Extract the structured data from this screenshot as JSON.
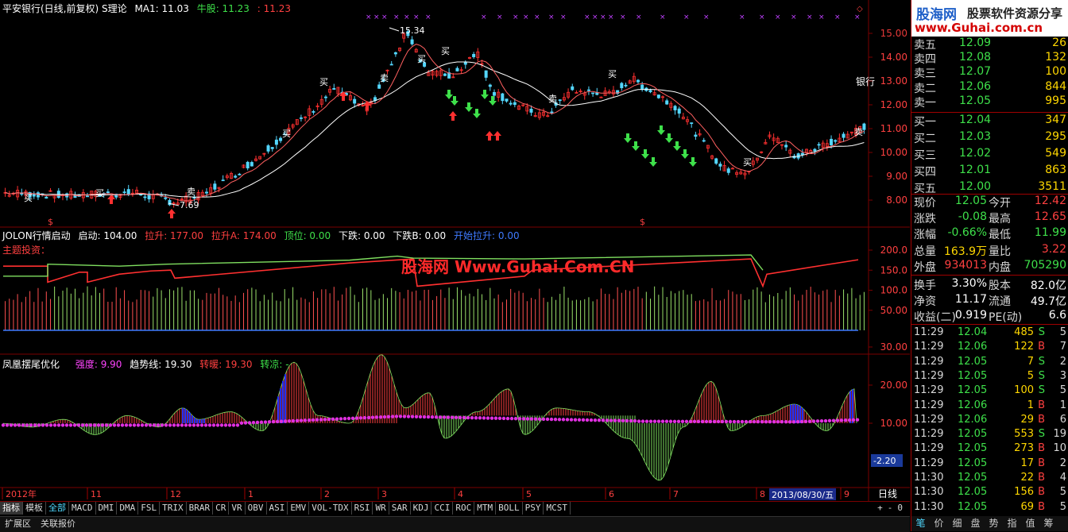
{
  "main_chart": {
    "title": "平安银行(日线,前复权) S理论",
    "ma1_label": "MA1: 11.03",
    "bull_label": "牛股: 11.23",
    "bull_value2": ": 11.23",
    "high_label": "15.34",
    "low_label": "7.69",
    "stock_tag": "银行",
    "y_ticks": [
      "15.00",
      "14.00",
      "13.00",
      "12.00",
      "11.00",
      "10.00",
      "9.00",
      "8.00"
    ],
    "buy_mark": "买",
    "sell_mark": "卖"
  },
  "ind1": {
    "name": "JOLON行情启动",
    "start": "启动: 104.00",
    "rise": "拉升: 177.00",
    "riseA": "拉升A: 174.00",
    "top": "顶位: 0.00",
    "down": "下跌: 0.00",
    "downB": "下跌B: 0.00",
    "begin_rise": "开始拉升: 0.00",
    "sub_label": "主题投资：",
    "y_ticks": [
      "200.0",
      "150.0",
      "100.0",
      "50.00"
    ]
  },
  "watermark": "股海网 Www.Guhai.Com.CN",
  "ind2": {
    "name": "凤凰摆尾优化",
    "strength": "强度: 9.90",
    "trend": "趋势线: 19.30",
    "warm": "转暖: 19.30",
    "cool": "转凉: -",
    "y_ticks": [
      "30.00",
      "20.00",
      "10.00"
    ],
    "current": "-2.20"
  },
  "time_axis": {
    "labels": [
      "2012年",
      "11",
      "12",
      "1",
      "2",
      "3",
      "4",
      "5",
      "6",
      "7",
      "8",
      "9"
    ],
    "date_box": "2013/08/30/五",
    "period": "日线"
  },
  "toolbar": {
    "tabs": [
      "指标",
      "模板",
      "全部",
      "MACD",
      "DMI",
      "DMA",
      "FSL",
      "TRIX",
      "BRAR",
      "CR",
      "VR",
      "OBV",
      "ASI",
      "EMV",
      "VOL-TDX",
      "RSI",
      "WR",
      "SAR",
      "KDJ",
      "CCI",
      "ROC",
      "MTM",
      "BOLL",
      "PSY",
      "MCST"
    ],
    "right_controls": [
      "+",
      "-",
      "0"
    ]
  },
  "bottombar": {
    "tabs": [
      "扩展区",
      "关联报价"
    ]
  },
  "brand": {
    "logo": "股海网",
    "slogan": "股票软件资源分享",
    "url": "www.Guhai.com.cn"
  },
  "order_book": {
    "sell": [
      {
        "label": "卖五",
        "price": "12.09",
        "vol": "26"
      },
      {
        "label": "卖四",
        "price": "12.08",
        "vol": "132"
      },
      {
        "label": "卖三",
        "price": "12.07",
        "vol": "100"
      },
      {
        "label": "卖二",
        "price": "12.06",
        "vol": "844"
      },
      {
        "label": "卖一",
        "price": "12.05",
        "vol": "995"
      }
    ],
    "buy": [
      {
        "label": "买一",
        "price": "12.04",
        "vol": "347"
      },
      {
        "label": "买二",
        "price": "12.03",
        "vol": "295"
      },
      {
        "label": "买三",
        "price": "12.02",
        "vol": "549"
      },
      {
        "label": "买四",
        "price": "12.01",
        "vol": "863"
      },
      {
        "label": "买五",
        "price": "12.00",
        "vol": "3511"
      }
    ]
  },
  "quote": {
    "rows": [
      {
        "k1": "现价",
        "v1": "12.05",
        "c1": "green",
        "k2": "今开",
        "v2": "12.42",
        "c2": "red"
      },
      {
        "k1": "涨跌",
        "v1": "-0.08",
        "c1": "green",
        "k2": "最高",
        "v2": "12.65",
        "c2": "red"
      },
      {
        "k1": "涨幅",
        "v1": "-0.66%",
        "c1": "green",
        "k2": "最低",
        "v2": "11.99",
        "c2": "green"
      },
      {
        "k1": "总量",
        "v1": "163.9万",
        "c1": "yellow",
        "k2": "量比",
        "v2": "3.22",
        "c2": "red"
      },
      {
        "k1": "外盘",
        "v1": "934013",
        "c1": "red",
        "k2": "内盘",
        "v2": "705290",
        "c2": "green"
      },
      {
        "k1": "换手",
        "v1": "3.30%",
        "c1": "white",
        "k2": "股本",
        "v2": "82.0亿",
        "c2": "white"
      },
      {
        "k1": "净资",
        "v1": "11.17",
        "c1": "white",
        "k2": "流通",
        "v2": "49.7亿",
        "c2": "white"
      },
      {
        "k1": "收益(二)",
        "v1": "0.919",
        "c1": "white",
        "k2": "PE(动)",
        "v2": "6.6",
        "c2": "white"
      }
    ]
  },
  "ticks": [
    {
      "t": "11:29",
      "p": "12.04",
      "pc": "green",
      "v": "485",
      "bs": "S",
      "n": "5"
    },
    {
      "t": "11:29",
      "p": "12.06",
      "pc": "green",
      "v": "122",
      "bs": "B",
      "n": "7"
    },
    {
      "t": "11:29",
      "p": "12.05",
      "pc": "green",
      "v": "7",
      "bs": "S",
      "n": "2"
    },
    {
      "t": "11:29",
      "p": "12.05",
      "pc": "green",
      "v": "5",
      "bs": "S",
      "n": "3"
    },
    {
      "t": "11:29",
      "p": "12.05",
      "pc": "green",
      "v": "100",
      "bs": "S",
      "n": "5"
    },
    {
      "t": "11:29",
      "p": "12.06",
      "pc": "green",
      "v": "1",
      "bs": "B",
      "n": "1"
    },
    {
      "t": "11:29",
      "p": "12.06",
      "pc": "green",
      "v": "29",
      "bs": "B",
      "n": "6"
    },
    {
      "t": "11:29",
      "p": "12.05",
      "pc": "green",
      "v": "553",
      "bs": "S",
      "n": "19",
      "vc": "mag"
    },
    {
      "t": "11:29",
      "p": "12.05",
      "pc": "green",
      "v": "273",
      "bs": "B",
      "n": "10"
    },
    {
      "t": "11:29",
      "p": "12.05",
      "pc": "green",
      "v": "17",
      "bs": "B",
      "n": "2"
    },
    {
      "t": "11:30",
      "p": "12.05",
      "pc": "green",
      "v": "22",
      "bs": "B",
      "n": "4"
    },
    {
      "t": "11:30",
      "p": "12.05",
      "pc": "green",
      "v": "156",
      "bs": "B",
      "n": "5"
    },
    {
      "t": "11:30",
      "p": "12.05",
      "pc": "green",
      "v": "69",
      "bs": "B",
      "n": "5"
    }
  ],
  "right_tabs": [
    "笔",
    "价",
    "细",
    "盘",
    "势",
    "指",
    "值",
    "筹"
  ],
  "colors": {
    "up": "#ff3030",
    "down": "#3ee04a",
    "ma": "#ffffff",
    "bg": "#000000",
    "grid": "#7a0000",
    "magenta": "#ff44ff"
  }
}
